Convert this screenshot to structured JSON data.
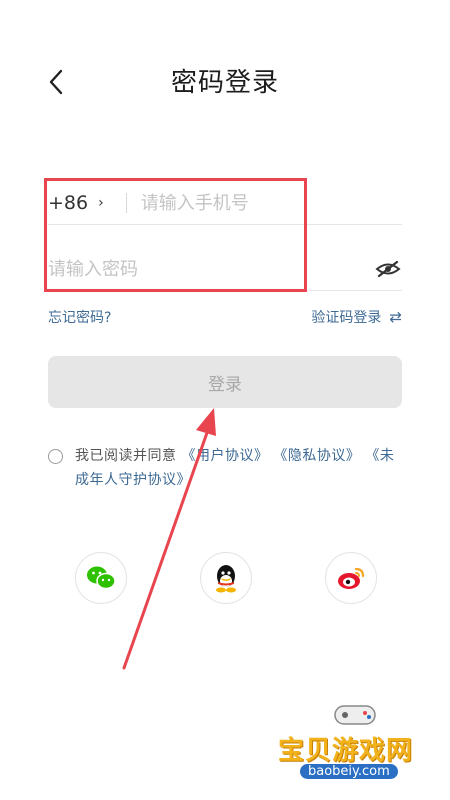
{
  "header": {
    "title": "密码登录",
    "back_icon": "chevron-left-icon"
  },
  "form": {
    "country_code": "+86",
    "country_chevron": "›",
    "phone_placeholder": "请输入手机号",
    "password_placeholder": "请输入密码",
    "eye_icon": "eye-closed-icon"
  },
  "links": {
    "forgot": "忘记密码?",
    "sms_login": "验证码登录",
    "swap_icon": "⇄"
  },
  "login_button": "登录",
  "agreement": {
    "prefix": "我已阅读并同意",
    "user": "《用户协议》",
    "privacy": "《隐私协议》",
    "minor": "《未成年人守护协议》"
  },
  "social": [
    "wechat-icon",
    "qq-icon",
    "weibo-icon"
  ],
  "watermark": {
    "title": "宝贝游戏网",
    "url": "baobeiy.com"
  },
  "colors": {
    "link": "#3e6a94",
    "annotation": "#e8454f",
    "button_bg": "#e6e6e6"
  }
}
